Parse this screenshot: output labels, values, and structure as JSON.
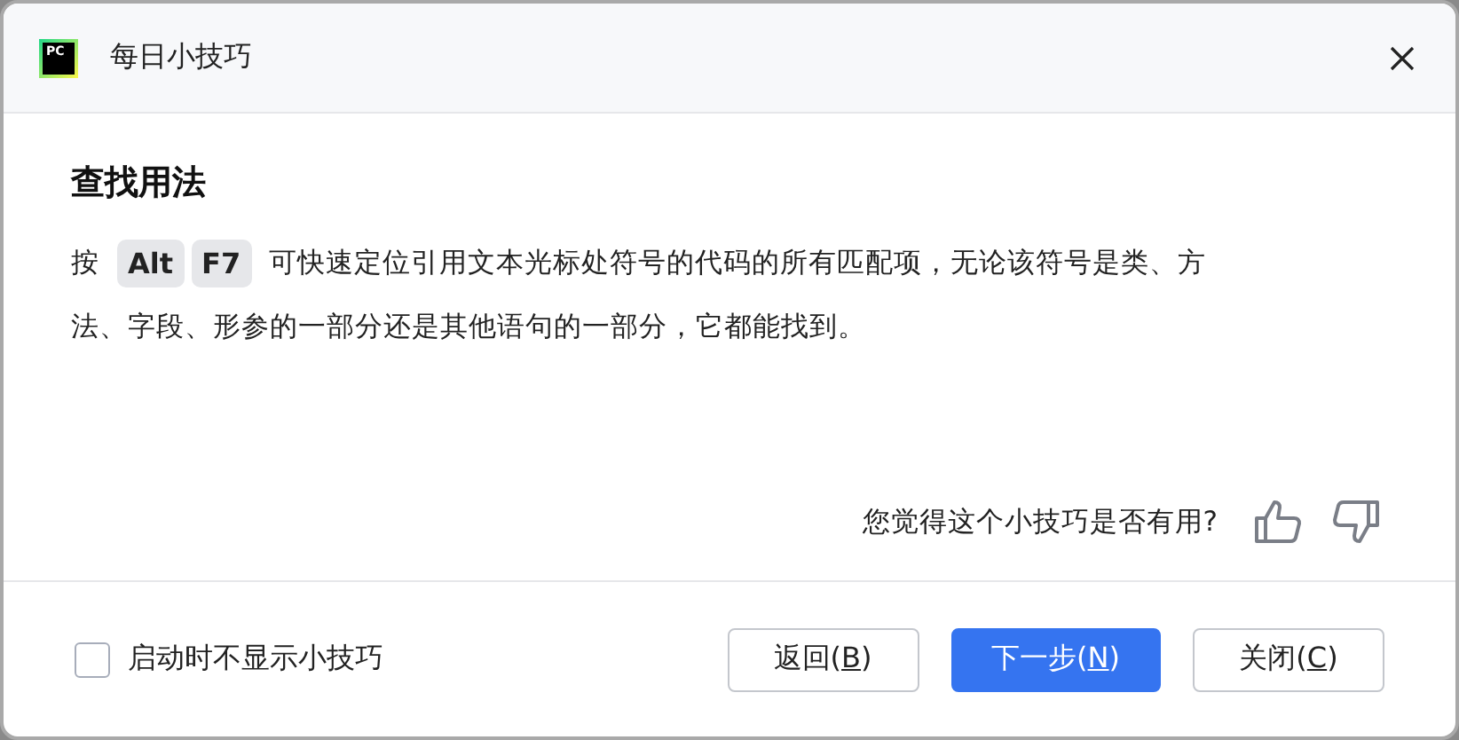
{
  "window": {
    "title": "每日小技巧",
    "logo_text": "PC"
  },
  "tip": {
    "title": "查找用法",
    "lines": [
      [
        {
          "kind": "text",
          "text": "按"
        },
        {
          "kind": "key",
          "text": "Alt"
        },
        {
          "kind": "key",
          "text": "F7"
        },
        {
          "kind": "text",
          "text": "可快速定位引用文本光标处符号的代码的所有匹配项，无论该符号是类、方"
        }
      ],
      [
        {
          "kind": "text",
          "text": "法、字段、形参的一部分还是其他语句的一部分，它都能找到。"
        }
      ]
    ]
  },
  "feedback": {
    "question": "您觉得这个小技巧是否有用?"
  },
  "dont_show": {
    "label": "启动时不显示小技巧",
    "checked": false
  },
  "buttons": [
    {
      "before": "返回(",
      "mnemonic": "B",
      "after": ")",
      "primary": false
    },
    {
      "before": "下一步(",
      "mnemonic": "N",
      "after": ")",
      "primary": true
    },
    {
      "before": "关闭(",
      "mnemonic": "C",
      "after": ")",
      "primary": false
    }
  ]
}
